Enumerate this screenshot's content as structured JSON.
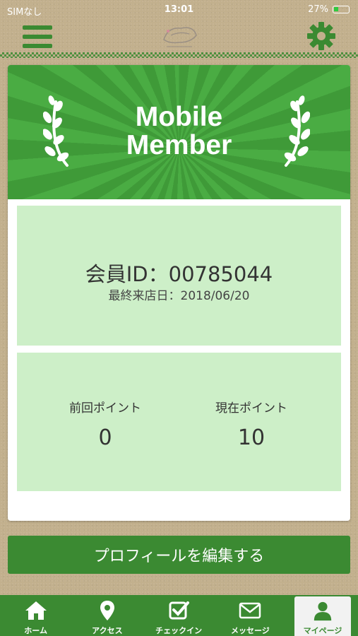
{
  "status_bar": {
    "carrier": "SIMなし",
    "time": "13:01",
    "battery": "27%"
  },
  "header": {
    "menu_icon": "hamburger-menu-icon",
    "logo_icon": "shop-logo-icon",
    "settings_icon": "gear-icon"
  },
  "banner": {
    "title_line1": "Mobile",
    "title_line2": "Member"
  },
  "member": {
    "id_text": "会員ID：00785044",
    "last_visit_text": "最終来店日：2018/06/20"
  },
  "points": {
    "previous_label": "前回ポイント",
    "previous_value": "0",
    "current_label": "現在ポイント",
    "current_value": "10"
  },
  "edit_profile_label": "プロフィールを編集する",
  "tabs": [
    {
      "label": "ホーム",
      "icon": "home-icon"
    },
    {
      "label": "アクセス",
      "icon": "map-pin-icon"
    },
    {
      "label": "チェックイン",
      "icon": "checkbox-icon"
    },
    {
      "label": "メッセージ",
      "icon": "envelope-icon"
    },
    {
      "label": "マイページ",
      "icon": "person-icon"
    }
  ],
  "colors": {
    "brand_green": "#3b8a32",
    "panel_green": "#cdefc8",
    "background": "#c2b08d"
  }
}
